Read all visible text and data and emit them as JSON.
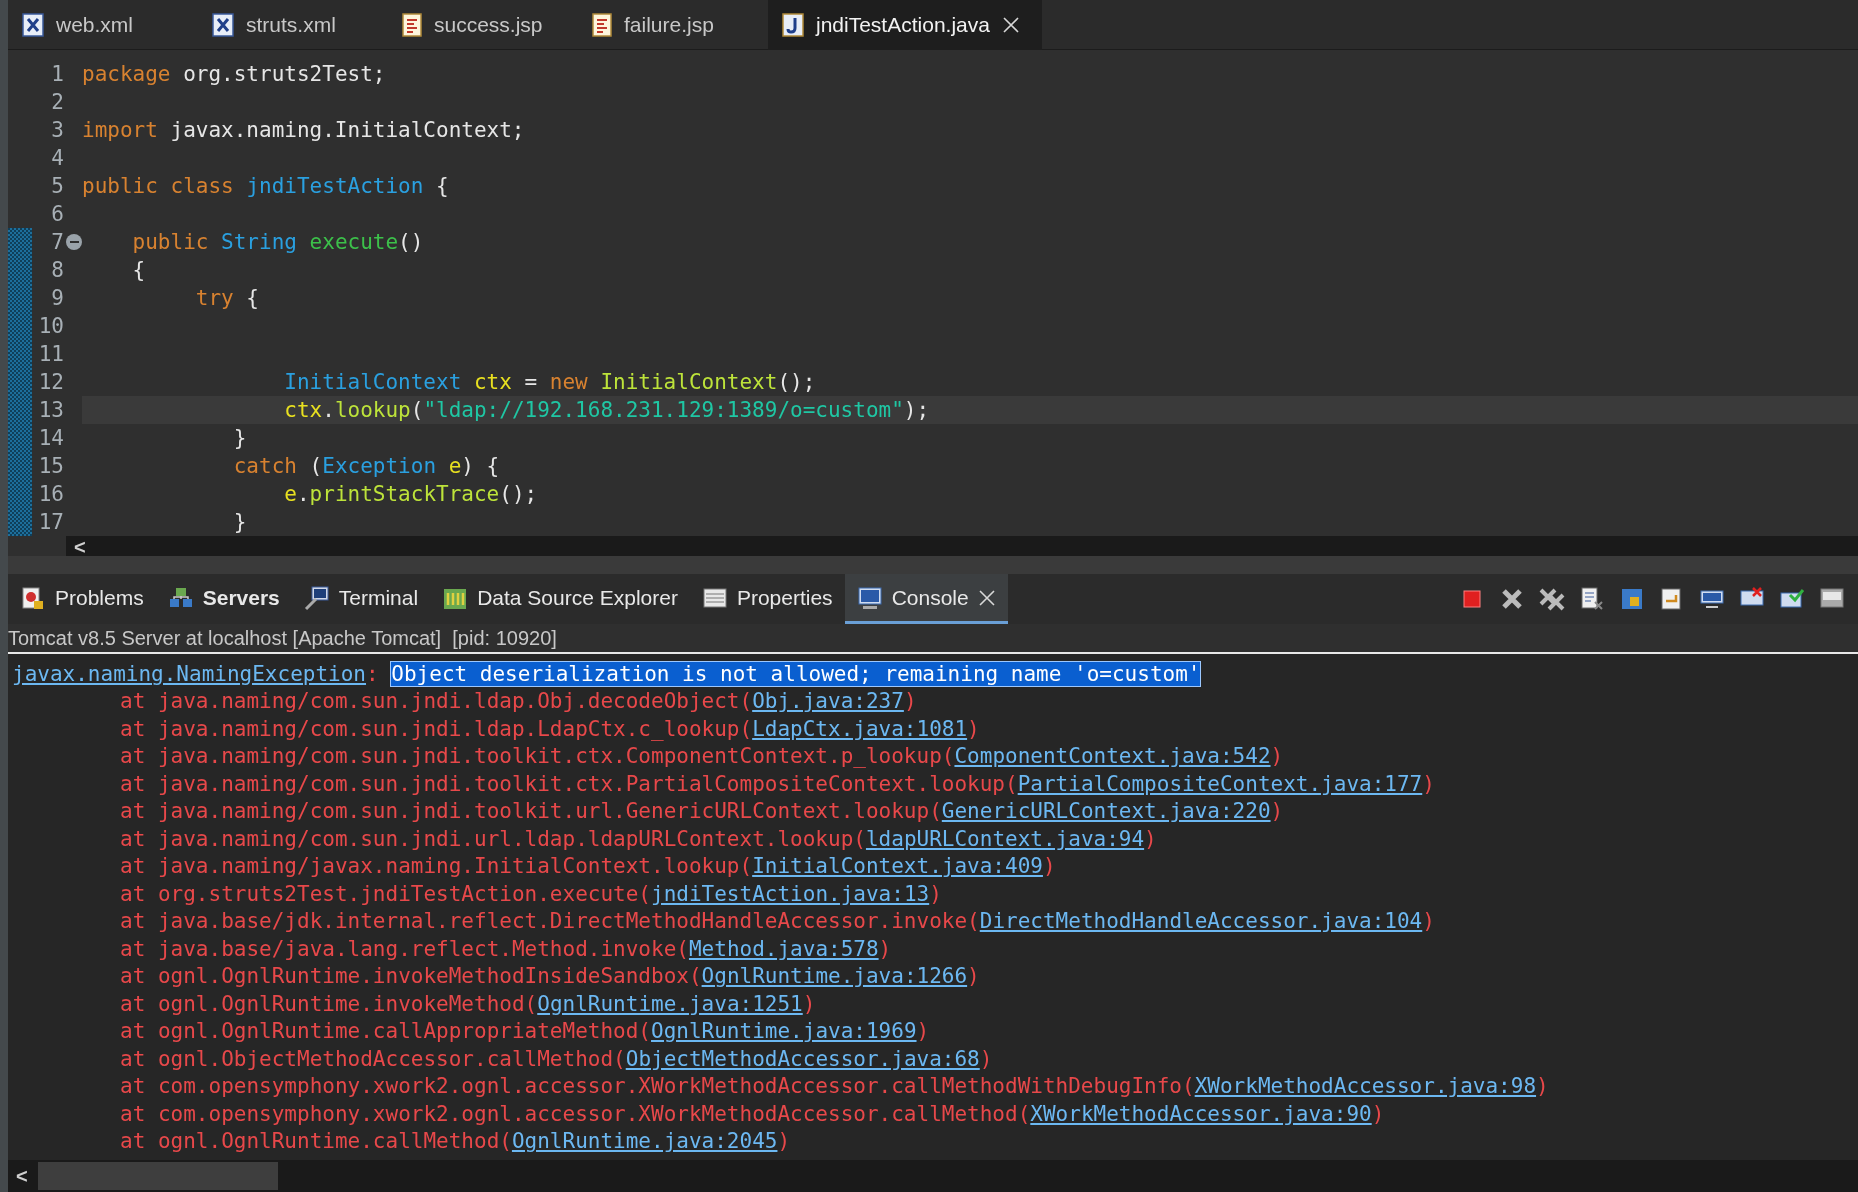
{
  "editor_tabs": [
    {
      "label": "web.xml",
      "kind": "xml",
      "selected": false
    },
    {
      "label": "struts.xml",
      "kind": "xml",
      "selected": false
    },
    {
      "label": "success.jsp",
      "kind": "jsp",
      "selected": false
    },
    {
      "label": "failure.jsp",
      "kind": "jsp",
      "selected": false
    },
    {
      "label": "jndiTestAction.java",
      "kind": "java",
      "selected": true
    }
  ],
  "code_lines": [
    {
      "number": "1",
      "changed": false,
      "fold_marker": false,
      "current": false,
      "tokens": [
        {
          "kind": "keyword",
          "text": "package"
        },
        {
          "kind": "plain",
          "text": " org.struts2Test;"
        }
      ]
    },
    {
      "number": "2",
      "changed": false,
      "fold_marker": false,
      "current": false
    },
    {
      "number": "3",
      "changed": false,
      "fold_marker": false,
      "current": false,
      "tokens": [
        {
          "kind": "keyword",
          "text": "import"
        },
        {
          "kind": "plain",
          "text": " javax.naming.InitialContext;"
        }
      ]
    },
    {
      "number": "4",
      "changed": false,
      "fold_marker": false,
      "current": false
    },
    {
      "number": "5",
      "changed": false,
      "fold_marker": false,
      "current": false,
      "tokens": [
        {
          "kind": "keyword",
          "text": "public "
        },
        {
          "kind": "keyword",
          "text": "class "
        },
        {
          "kind": "type",
          "text": "jndiTestAction"
        },
        {
          "kind": "plain",
          "text": " {"
        }
      ]
    },
    {
      "number": "6",
      "changed": false,
      "fold_marker": false,
      "current": false
    },
    {
      "number": "7",
      "changed": true,
      "fold_marker": true,
      "current": false,
      "tokens": [
        {
          "kind": "keyword",
          "text": "    public "
        },
        {
          "kind": "type",
          "text": "String "
        },
        {
          "kind": "method",
          "text": "execute"
        },
        {
          "kind": "plain",
          "text": "()"
        }
      ]
    },
    {
      "number": "8",
      "changed": true,
      "fold_marker": false,
      "current": false,
      "tokens": [
        {
          "kind": "plain",
          "text": "    {"
        }
      ]
    },
    {
      "number": "9",
      "changed": true,
      "fold_marker": false,
      "current": false,
      "tokens": [
        {
          "kind": "keyword",
          "text": "         try"
        },
        {
          "kind": "plain",
          "text": " {"
        }
      ]
    },
    {
      "number": "10",
      "changed": true,
      "fold_marker": false,
      "current": false
    },
    {
      "number": "11",
      "changed": true,
      "fold_marker": false,
      "current": false
    },
    {
      "number": "12",
      "changed": true,
      "fold_marker": false,
      "current": false,
      "tokens": [
        {
          "kind": "type",
          "text": "                InitialContext "
        },
        {
          "kind": "variable",
          "text": "ctx"
        },
        {
          "kind": "plain",
          "text": " = "
        },
        {
          "kind": "keyword",
          "text": "new "
        },
        {
          "kind": "call",
          "text": "InitialContext"
        },
        {
          "kind": "plain",
          "text": "();"
        }
      ]
    },
    {
      "number": "13",
      "changed": true,
      "fold_marker": false,
      "current": true,
      "tokens": [
        {
          "kind": "variable",
          "text": "                ctx"
        },
        {
          "kind": "plain",
          "text": "."
        },
        {
          "kind": "call",
          "text": "lookup"
        },
        {
          "kind": "plain",
          "text": "("
        },
        {
          "kind": "string",
          "text": "\"ldap://192.168.231.129:1389/o=custom\""
        },
        {
          "kind": "plain",
          "text": ");"
        }
      ]
    },
    {
      "number": "14",
      "changed": true,
      "fold_marker": false,
      "current": false,
      "tokens": [
        {
          "kind": "plain",
          "text": "            }"
        }
      ]
    },
    {
      "number": "15",
      "changed": true,
      "fold_marker": false,
      "current": false,
      "tokens": [
        {
          "kind": "keyword",
          "text": "            catch"
        },
        {
          "kind": "plain",
          "text": " ("
        },
        {
          "kind": "type",
          "text": "Exception "
        },
        {
          "kind": "variable",
          "text": "e"
        },
        {
          "kind": "plain",
          "text": ") {"
        }
      ]
    },
    {
      "number": "16",
      "changed": true,
      "fold_marker": false,
      "current": false,
      "tokens": [
        {
          "kind": "variable",
          "text": "                e"
        },
        {
          "kind": "plain",
          "text": "."
        },
        {
          "kind": "call",
          "text": "printStackTrace"
        },
        {
          "kind": "plain",
          "text": "();"
        }
      ]
    },
    {
      "number": "17",
      "changed": true,
      "fold_marker": false,
      "current": false,
      "tokens": [
        {
          "kind": "plain",
          "text": "            }"
        }
      ]
    }
  ],
  "editor_scroll_left": "<",
  "panel_tabs": [
    {
      "label": "Problems",
      "kind": "problems",
      "emphasized": false,
      "selected": false
    },
    {
      "label": "Servers",
      "kind": "servers",
      "emphasized": true,
      "selected": false
    },
    {
      "label": "Terminal",
      "kind": "terminal",
      "emphasized": false,
      "selected": false
    },
    {
      "label": "Data Source Explorer",
      "kind": "datasource",
      "emphasized": false,
      "selected": false
    },
    {
      "label": "Properties",
      "kind": "properties",
      "emphasized": false,
      "selected": false
    },
    {
      "label": "Console",
      "kind": "console",
      "emphasized": false,
      "selected": true
    }
  ],
  "console": {
    "title": "Tomcat v8.5 Server at localhost [Apache Tomcat]  [pid: 10920]",
    "exception": {
      "link": "javax.naming.NamingException",
      "separator": ": ",
      "message": "Object deserialization is not allowed; remaining name 'o=custom'",
      "message_selected": true
    },
    "trace": [
      {
        "text": "at java.naming/com.sun.jndi.ldap.Obj.decodeObject(",
        "link": "Obj.java:237",
        "close": ")"
      },
      {
        "text": "at java.naming/com.sun.jndi.ldap.LdapCtx.c_lookup(",
        "link": "LdapCtx.java:1081",
        "close": ")"
      },
      {
        "text": "at java.naming/com.sun.jndi.toolkit.ctx.ComponentContext.p_lookup(",
        "link": "ComponentContext.java:542",
        "close": ")"
      },
      {
        "text": "at java.naming/com.sun.jndi.toolkit.ctx.PartialCompositeContext.lookup(",
        "link": "PartialCompositeContext.java:177",
        "close": ")"
      },
      {
        "text": "at java.naming/com.sun.jndi.toolkit.url.GenericURLContext.lookup(",
        "link": "GenericURLContext.java:220",
        "close": ")"
      },
      {
        "text": "at java.naming/com.sun.jndi.url.ldap.ldapURLContext.lookup(",
        "link": "ldapURLContext.java:94",
        "close": ")"
      },
      {
        "text": "at java.naming/javax.naming.InitialContext.lookup(",
        "link": "InitialContext.java:409",
        "close": ")"
      },
      {
        "text": "at org.struts2Test.jndiTestAction.execute(",
        "link": "jndiTestAction.java:13",
        "close": ")"
      },
      {
        "text": "at java.base/jdk.internal.reflect.DirectMethodHandleAccessor.invoke(",
        "link": "DirectMethodHandleAccessor.java:104",
        "close": ")"
      },
      {
        "text": "at java.base/java.lang.reflect.Method.invoke(",
        "link": "Method.java:578",
        "close": ")"
      },
      {
        "text": "at ognl.OgnlRuntime.invokeMethodInsideSandbox(",
        "link": "OgnlRuntime.java:1266",
        "close": ")"
      },
      {
        "text": "at ognl.OgnlRuntime.invokeMethod(",
        "link": "OgnlRuntime.java:1251",
        "close": ")"
      },
      {
        "text": "at ognl.OgnlRuntime.callAppropriateMethod(",
        "link": "OgnlRuntime.java:1969",
        "close": ")"
      },
      {
        "text": "at ognl.ObjectMethodAccessor.callMethod(",
        "link": "ObjectMethodAccessor.java:68",
        "close": ")"
      },
      {
        "text": "at com.opensymphony.xwork2.ognl.accessor.XWorkMethodAccessor.callMethodWithDebugInfo(",
        "link": "XWorkMethodAccessor.java:98",
        "close": ")"
      },
      {
        "text": "at com.opensymphony.xwork2.ognl.accessor.XWorkMethodAccessor.callMethod(",
        "link": "XWorkMethodAccessor.java:90",
        "close": ")"
      },
      {
        "text": "at ognl.OgnlRuntime.callMethod(",
        "link": "OgnlRuntime.java:2045",
        "close": ")"
      }
    ],
    "scroll_left": "<"
  }
}
